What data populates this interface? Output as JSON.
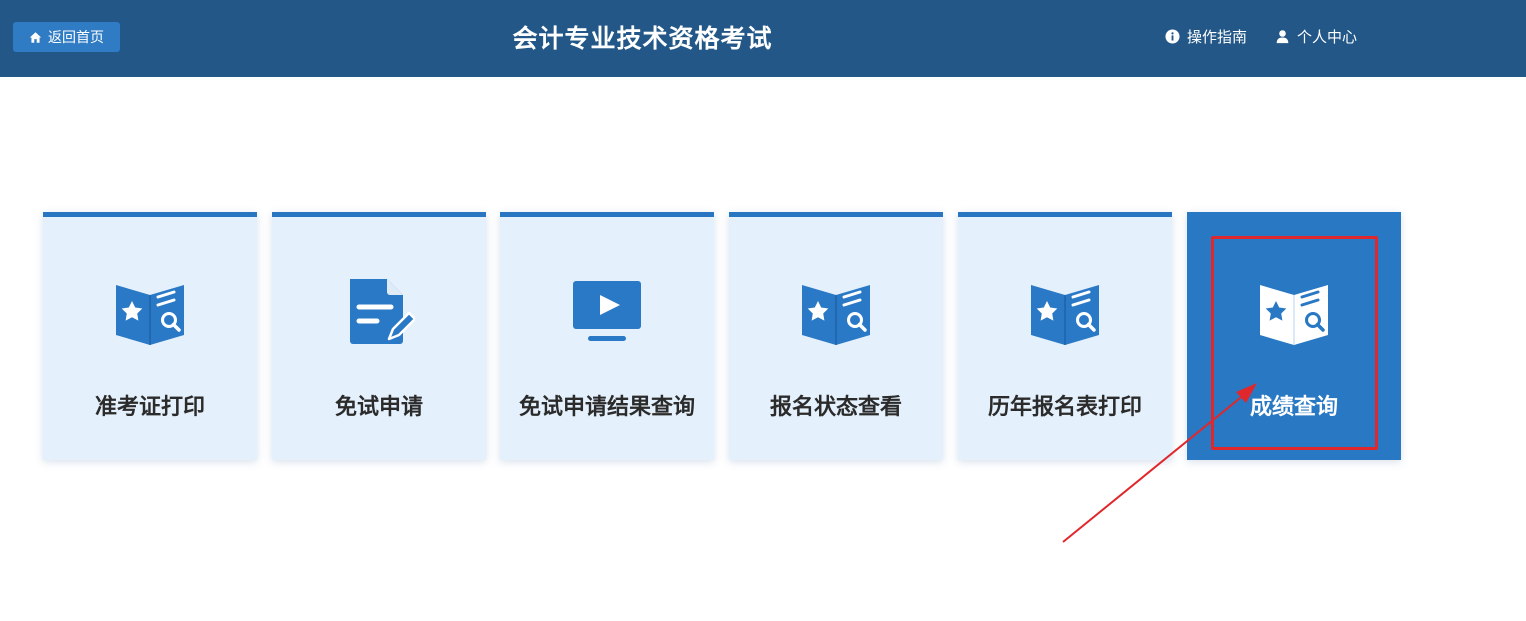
{
  "header": {
    "home_label": "返回首页",
    "title": "会计专业技术资格考试",
    "guide_label": "操作指南",
    "user_label": "个人中心",
    "background_color": "#225787"
  },
  "cards": [
    {
      "label": "准考证打印",
      "icon": "book-star-search-icon"
    },
    {
      "label": "免试申请",
      "icon": "document-edit-icon"
    },
    {
      "label": "免试申请结果查询",
      "icon": "monitor-play-icon"
    },
    {
      "label": "报名状态查看",
      "icon": "book-star-search-icon"
    },
    {
      "label": "历年报名表打印",
      "icon": "book-star-search-icon"
    },
    {
      "label": "成绩查询",
      "icon": "book-star-search-icon",
      "active": true
    }
  ],
  "colors": {
    "accent": "#2876c2",
    "card_bg": "#e4f0fb",
    "active_card_bg": "#2878c3",
    "annotation": "#e0282c"
  }
}
